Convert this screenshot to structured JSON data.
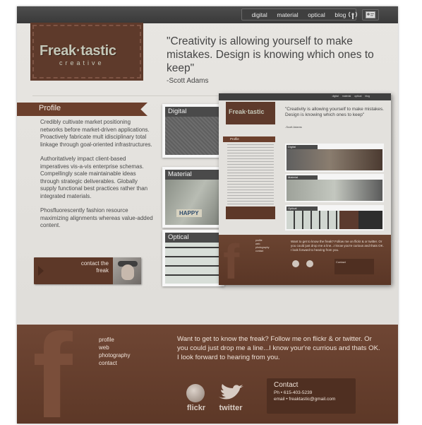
{
  "nav": {
    "items": [
      "digital",
      "material",
      "optical",
      "blog"
    ]
  },
  "logo": {
    "main": "Freak·tastic",
    "sub": "creative"
  },
  "quote": {
    "text": "\"Creativity is allowing yourself to make mistakes. Design is knowing which ones to keep\"",
    "author": "-Scott Adams"
  },
  "profile": {
    "title": "Profile",
    "paragraphs": [
      "Credibly cultivate market positioning networks before market-driven applications. Proactively fabricate mult idisciplinary total linkage through goal-oriented infrastructures.",
      "Authoritatively impact client-based imperatives vis-a-vis enterprise schemas. Compellingly scale maintainable ideas through strategic deliverables. Globally supply functional best practices rather than integrated materials.",
      "Phosfluorescently fashion resource maximizing alignments whereas value-added content."
    ],
    "contact_label": "contact the freak"
  },
  "portfolio": {
    "digital": "Digital",
    "material": "Material",
    "optical": "Optical",
    "material_sign": "HAPPY"
  },
  "preview": {
    "nav": [
      "digital",
      "material",
      "optical",
      "blog"
    ],
    "logo": "Freak·tastic",
    "quote": "\"Creativity is allowing yourself to make mistakes. Design is knowing which ones to keep\"",
    "author": "-Scott Adams",
    "profile": "Profile",
    "digital": "Digital",
    "material": "Material",
    "optical": "Optical",
    "links": [
      "profile",
      "web",
      "photography",
      "contact"
    ],
    "footer_text": "Want to get to know the freak? Follow me on flickr & or twitter. Or you could just drop me a line...I know you're curious and thats OK. I look forward to hearing from you.",
    "contact": "Contact"
  },
  "footer": {
    "links": [
      "profile",
      "web",
      "photography",
      "contact"
    ],
    "text": "Want to get to know the freak? Follow me on flickr & or twitter. Or you could just drop me a line...I know your're currious and thats OK.  I look forward to hearing from you.",
    "flickr": "flickr",
    "twitter": "twitter",
    "contact": {
      "title": "Contact",
      "phone": "Ph • 615-403-5239",
      "email": "email • freaktastic@gmail.com"
    }
  },
  "colors": {
    "brown": "#6b3f2c",
    "dark_brown": "#5d3828",
    "bar": "#3f3f3f",
    "background": "#e3e1dd"
  }
}
